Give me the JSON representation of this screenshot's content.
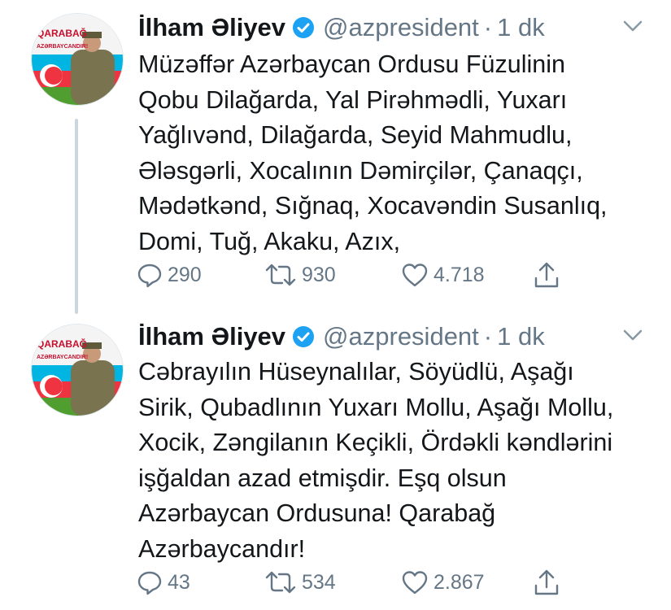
{
  "colors": {
    "text": "#14171a",
    "secondary": "#657786",
    "verified": "#1da1f2",
    "thread_line": "#ccd6dd"
  },
  "tweets": [
    {
      "author_name": "İlham Əliyev",
      "verified": true,
      "handle": "@azpresident",
      "separator": "·",
      "time": "1 dk",
      "avatar_text": "QARABAĞ AZƏRBAYCANDIR!",
      "text": "Müzəffər Azərbaycan Ordusu Füzulinin\nQobu Dilağarda, Yal Pirəhmədli, Yuxarı\nYağlıvənd, Dilağarda, Seyid Mahmudlu,\nƏləsgərli, Xocalının Dəmirçilər, Çanaqçı,\nMədətkənd, Sığnaq, Xocavəndin Susanlıq,\nDomi, Tuğ, Akaku, Azıx,",
      "replies": "290",
      "retweets": "930",
      "likes": "4.718",
      "icons": [
        "reply-icon",
        "retweet-icon",
        "like-icon",
        "share-icon",
        "caret-down-icon"
      ]
    },
    {
      "author_name": "İlham Əliyev",
      "verified": true,
      "handle": "@azpresident",
      "separator": "·",
      "time": "1 dk",
      "avatar_text": "QARABAĞ AZƏRBAYCANDIR!",
      "text": "Cəbrayılın Hüseynalılar, Söyüdlü, Aşağı\nSirik, Qubadlının Yuxarı Mollu, Aşağı Mollu,\nXocik, Zəngilanın Keçikli, Ördəkli kəndlərini\nişğaldan azad etmişdir. Eşq olsun\nAzərbaycan Ordusuna! Qarabağ\nAzərbaycandır!",
      "replies": "43",
      "retweets": "534",
      "likes": "2.867",
      "icons": [
        "reply-icon",
        "retweet-icon",
        "like-icon",
        "share-icon",
        "caret-down-icon"
      ]
    }
  ]
}
